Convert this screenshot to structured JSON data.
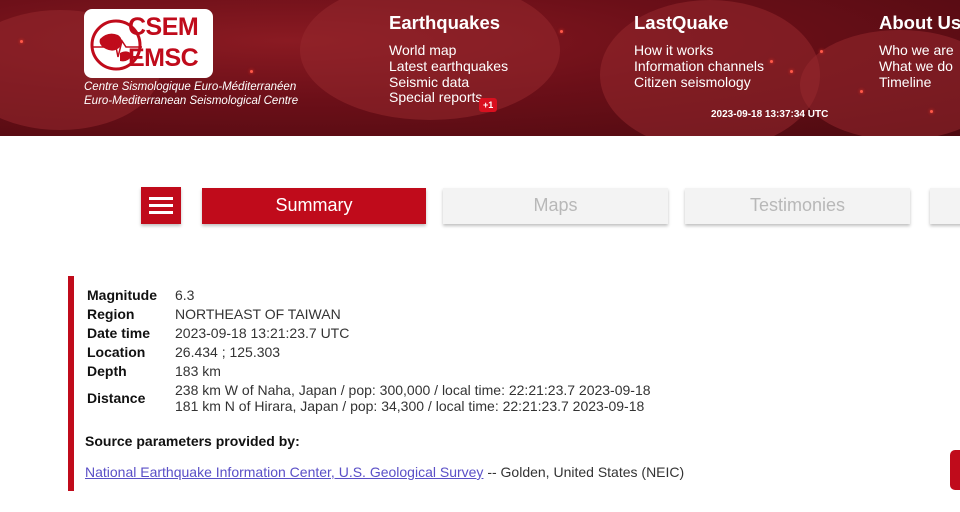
{
  "header": {
    "logo": {
      "line1": "CSEM",
      "line2": "EMSC"
    },
    "tagline_fr": "Centre Sismologique Euro-Méditerranéen",
    "tagline_en": "Euro-Mediterranean Seismological Centre",
    "nav": [
      {
        "heading": "Earthquakes",
        "links": [
          "World map",
          "Latest earthquakes",
          "Seismic data",
          "Special reports"
        ]
      },
      {
        "heading": "LastQuake",
        "links": [
          "How it works",
          "Information channels",
          "Citizen seismology"
        ]
      },
      {
        "heading": "About Us",
        "links": [
          "Who we are",
          "What we do",
          "Timeline"
        ]
      }
    ],
    "badge": "+1",
    "clock": "2023-09-18 13:37:34 UTC"
  },
  "tabs": [
    "Summary",
    "Maps",
    "Testimonies"
  ],
  "active_tab": "Summary",
  "event": {
    "rows": [
      {
        "label": "Magnitude",
        "value": "6.3"
      },
      {
        "label": "Region",
        "value": "NORTHEAST OF TAIWAN"
      },
      {
        "label": "Date time",
        "value": "2023-09-18 13:21:23.7 UTC"
      },
      {
        "label": "Location",
        "value": "26.434 ; 125.303"
      },
      {
        "label": "Depth",
        "value": "183 km"
      }
    ],
    "distance_label": "Distance",
    "distance_values": [
      "238 km W of Naha, Japan / pop: 300,000 / local time: 22:21:23.7 2023-09-18",
      "181 km N of Hirara, Japan / pop: 34,300 / local time: 22:21:23.7 2023-09-18"
    ],
    "source_title": "Source parameters provided by:",
    "source_link": "National Earthquake Information Center, U.S. Geological Survey",
    "source_suffix": " -- Golden, United States (NEIC)"
  },
  "colors": {
    "brand_red": "#c00b1b",
    "header_dark": "#6b0f18",
    "link": "#5a4fc7"
  }
}
